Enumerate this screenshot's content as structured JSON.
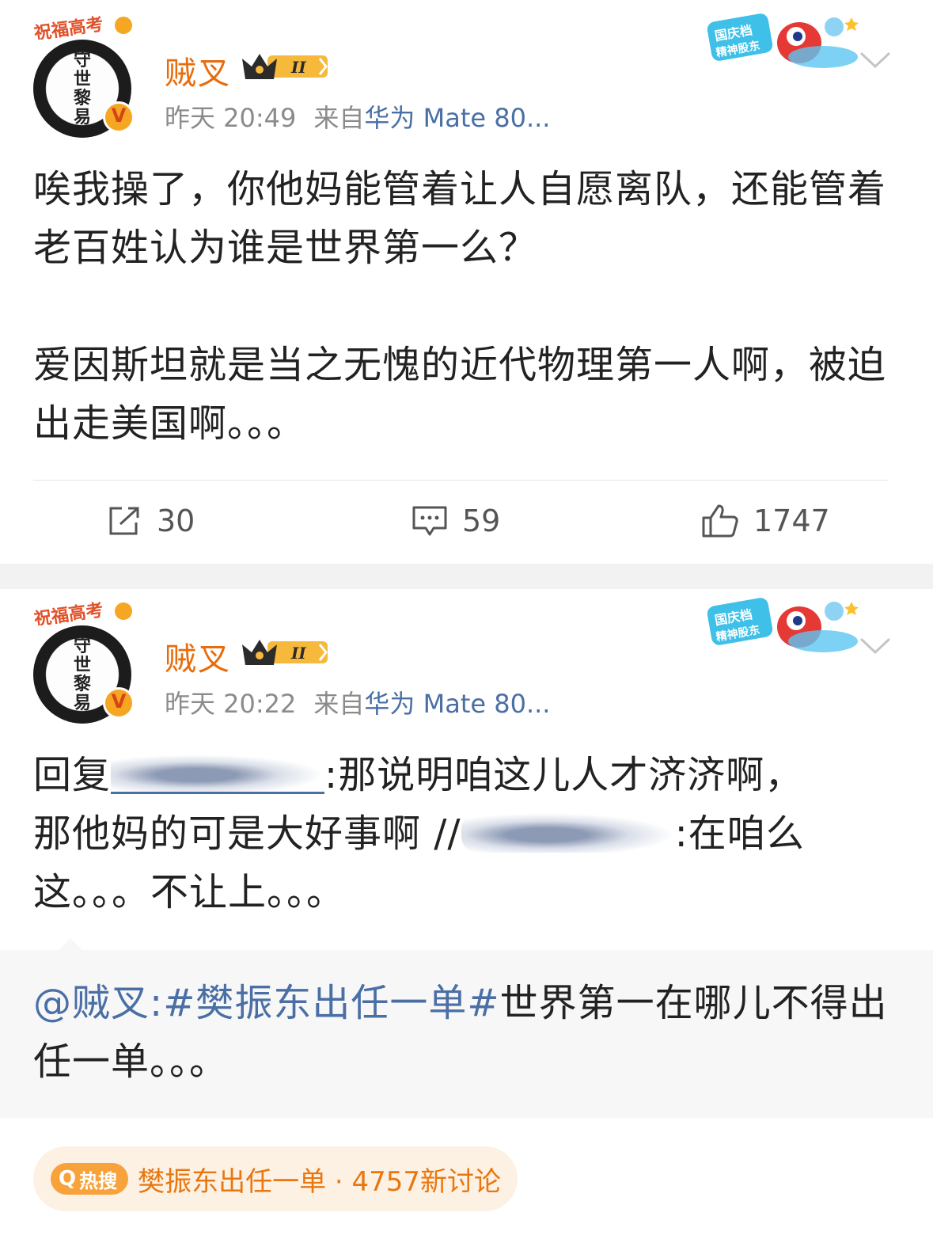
{
  "posts": [
    {
      "avatar_badge": "祝福高考",
      "avatar_calligraphy": "守世黎易",
      "username": "贼叉",
      "vip_level": "II",
      "time": "昨天 20:49",
      "source_prefix": "来自",
      "source_device": "华为 Mate 80...",
      "sticker_text": "国庆档精神股东",
      "paragraphs": [
        "唉我操了，你他妈能管着让人自愿离队，还能管着老百姓认为谁是世界第一么？",
        "爱因斯坦就是当之无愧的近代物理第一人啊，被迫出走美国啊。。。"
      ],
      "actions": {
        "repost": "30",
        "comment": "59",
        "like": "1747"
      }
    },
    {
      "avatar_badge": "祝福高考",
      "avatar_calligraphy": "守世黎易",
      "username": "贼叉",
      "vip_level": "II",
      "time": "昨天 20:22",
      "source_prefix": "来自",
      "source_device": "华为 Mate 80...",
      "sticker_text": "国庆档精神股东",
      "reply": {
        "prefix": "回复",
        "after_name_1": ":那说明咱这儿人才济济啊，",
        "line2_start": "那他妈的可是大好事啊 //",
        "after_name_2": ":在咱么",
        "line3": "这。。。不让上。。。"
      },
      "quote": {
        "mention": "@贼叉:",
        "hashtag": "#樊振东出任一单#",
        "rest_line1": "世界第一在哪儿不得出",
        "rest_line2": "任一单。。。"
      }
    }
  ],
  "hot_search": {
    "badge": "热搜",
    "text": "樊振东出任一单 · 4757新讨论"
  }
}
